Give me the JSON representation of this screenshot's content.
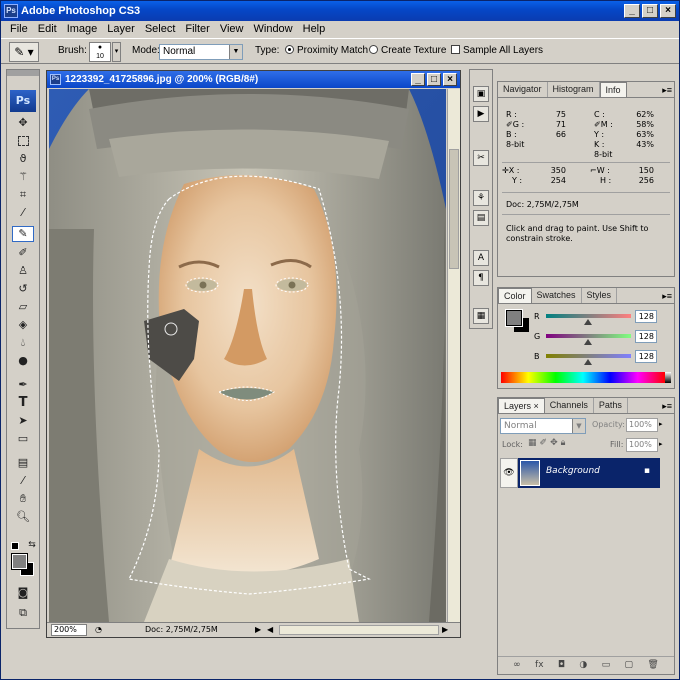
{
  "app": {
    "title": "Adobe Photoshop CS3",
    "icon": "Ps",
    "window_buttons": [
      "_",
      "□",
      "×"
    ]
  },
  "menu": [
    "File",
    "Edit",
    "Image",
    "Layer",
    "Select",
    "Filter",
    "View",
    "Window",
    "Help"
  ],
  "options": {
    "brush_label": "Brush:",
    "brush_size": "10",
    "mode_label": "Mode:",
    "mode_value": "Normal",
    "type_label": "Type:",
    "proximity": "Proximity Match",
    "texture": "Create Texture",
    "sample_all": "Sample All Layers"
  },
  "toolbox": {
    "badge": "Ps",
    "tools": [
      "move",
      "marquee",
      "lasso",
      "magic-wand",
      "crop",
      "slice",
      "spot-healing",
      "brush",
      "clone-stamp",
      "history-brush",
      "eraser",
      "paint-bucket",
      "blur",
      "dodge",
      "pen",
      "type",
      "path-select",
      "shape",
      "notes",
      "eyedropper",
      "hand",
      "zoom",
      "quick-mask",
      "screen-mode"
    ]
  },
  "document": {
    "title": "1223392_41725896.jpg @ 200% (RGB/8#)",
    "zoom": "200%",
    "doc_size": "Doc: 2,75M/2,75M"
  },
  "info_panel": {
    "tabs": [
      "Navigator",
      "Histogram",
      "Info"
    ],
    "rgb": {
      "r_label": "R :",
      "r": "75",
      "g_label": "G :",
      "g": "71",
      "b_label": "B :",
      "b": "66"
    },
    "cmyk": {
      "c_label": "C :",
      "c": "62%",
      "m_label": "M :",
      "m": "58%",
      "y_label": "Y :",
      "y": "63%",
      "k_label": "K :",
      "k": "43%"
    },
    "bit_left": "8-bit",
    "bit_right": "8-bit",
    "xy": {
      "x_label": "X :",
      "x": "350",
      "y_label": "Y :",
      "y": "254"
    },
    "wh": {
      "w_label": "W :",
      "w": "150",
      "h_label": "H :",
      "h": "256"
    },
    "doc": "Doc: 2,75M/2,75M",
    "hint": "Click and drag to paint. Use Shift to constrain stroke."
  },
  "color_panel": {
    "tabs": [
      "Color",
      "Swatches",
      "Styles"
    ],
    "channels": [
      {
        "label": "R",
        "value": "128"
      },
      {
        "label": "G",
        "value": "128"
      },
      {
        "label": "B",
        "value": "128"
      }
    ]
  },
  "layers_panel": {
    "tabs": [
      "Layers",
      "Channels",
      "Paths"
    ],
    "blend": "Normal",
    "opacity_label": "Opacity:",
    "opacity": "100%",
    "lock_label": "Lock:",
    "fill_label": "Fill:",
    "fill": "100%",
    "layer_name": "Background"
  },
  "colors": {
    "titlebar": "#0a48c8",
    "selection": "#0a246a",
    "sky": "#2b56a8"
  }
}
